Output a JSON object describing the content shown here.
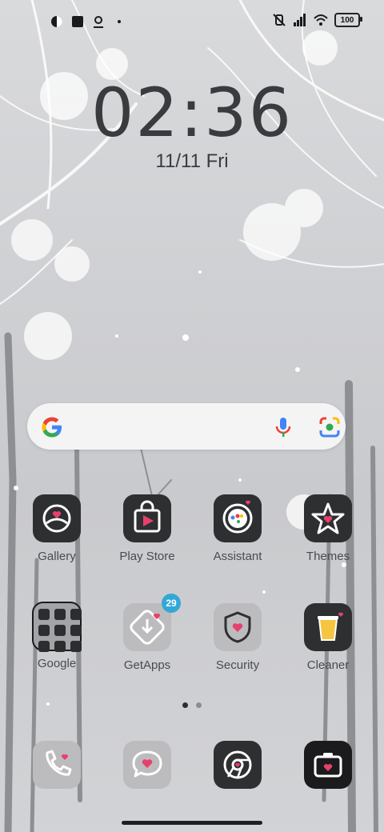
{
  "status_bar": {
    "left_icons": [
      "circle-half-icon",
      "square-icon",
      "person-pin-icon",
      "dot-icon"
    ],
    "right_icons": [
      "mute-vibrate-icon",
      "signal-icon",
      "wifi-icon"
    ],
    "battery": "100"
  },
  "clock": {
    "hours": "02",
    "separator": ":",
    "minutes": "36",
    "date": "11/11",
    "day": "Fri"
  },
  "search": {
    "icons": [
      "google-g-icon",
      "microphone-icon",
      "google-lens-icon"
    ]
  },
  "apps_row1": [
    {
      "label": "Gallery",
      "icon": "gallery-heart-icon"
    },
    {
      "label": "Play Store",
      "icon": "play-store-icon"
    },
    {
      "label": "Assistant",
      "icon": "assistant-icon"
    },
    {
      "label": "Themes",
      "icon": "themes-star-icon"
    }
  ],
  "apps_row2": [
    {
      "label": "Google",
      "icon": "google-folder-icon"
    },
    {
      "label": "GetApps",
      "icon": "getapps-icon",
      "badge": "29"
    },
    {
      "label": "Security",
      "icon": "security-shield-icon"
    },
    {
      "label": "Cleaner",
      "icon": "cleaner-bin-icon"
    }
  ],
  "dock": [
    {
      "icon": "phone-icon"
    },
    {
      "icon": "messages-icon"
    },
    {
      "icon": "chrome-icon"
    },
    {
      "icon": "camera-icon"
    }
  ],
  "page_indicator": {
    "pages": 2,
    "current": 1
  },
  "colors": {
    "accent_pink": "#e8406c",
    "badge_blue": "#33a8d6",
    "icon_dark": "#2e2f31",
    "icon_light": "#bcbcbe"
  }
}
